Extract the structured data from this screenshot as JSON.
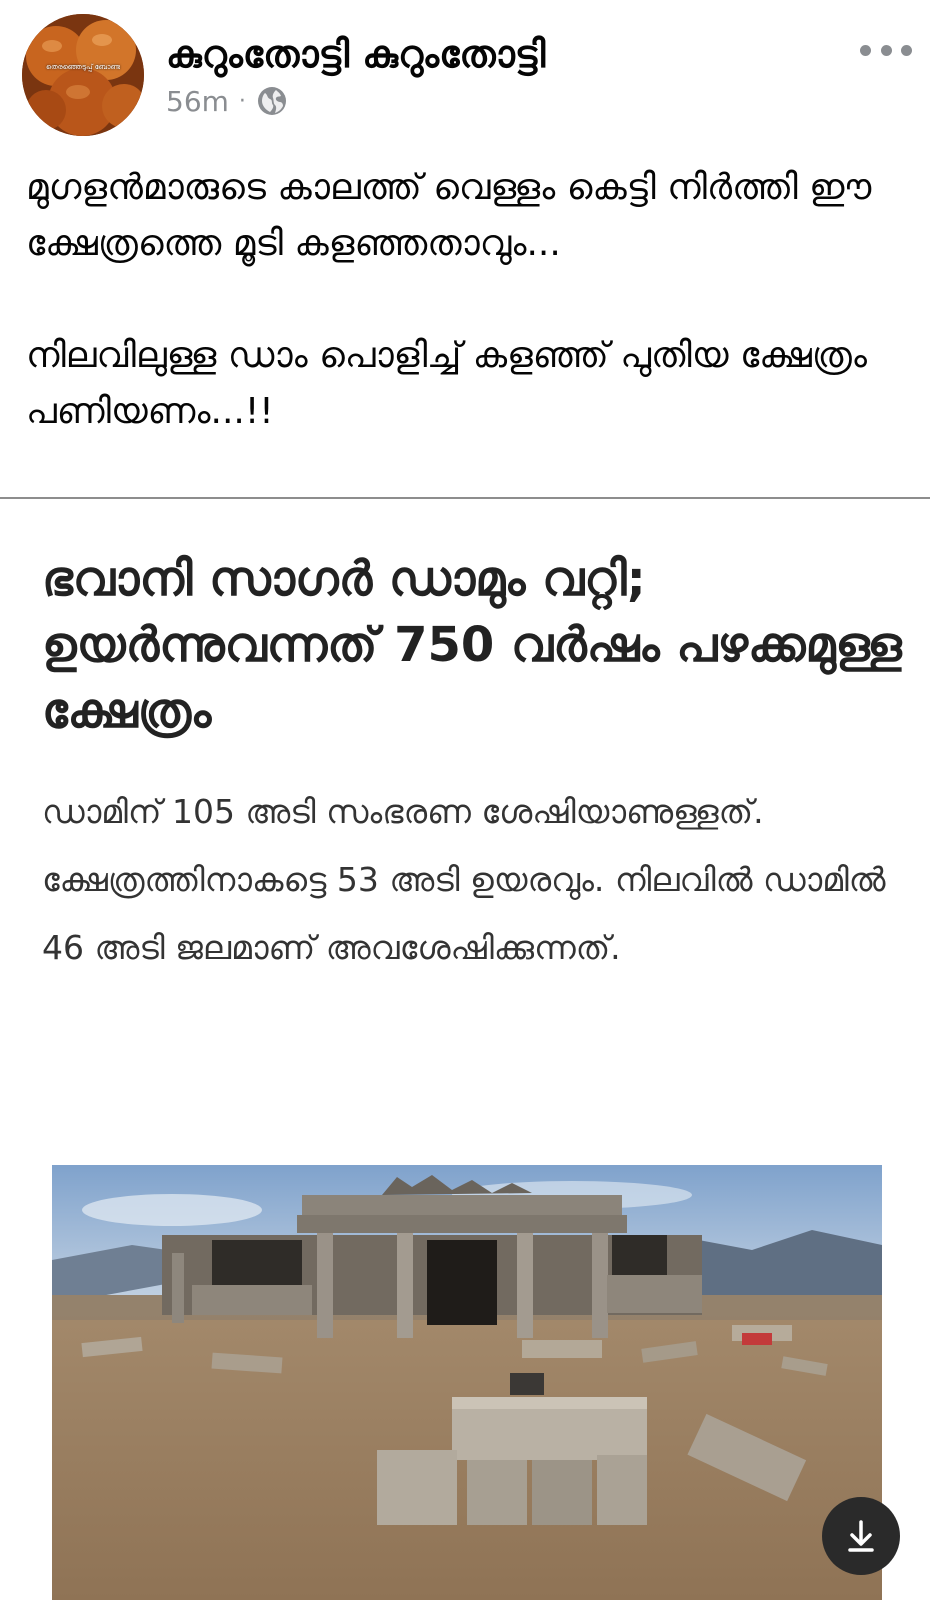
{
  "post": {
    "author_name": "കുറുംതോട്ടി കുറുംതോട്ടി",
    "timestamp": "56m",
    "meta_separator": "·",
    "privacy_icon": "globe-icon",
    "more_icon": "more-horizontal-icon",
    "avatar_caption": "തെരഞ്ഞെടുപ്പ് ബോണ്ട",
    "text_paragraphs": [
      "മുഗളൻമാരുടെ കാലത്ത് വെള്ളം കെട്ടി നിർത്തി ഈ ക്ഷേത്രത്തെ മൂടി കളഞ്ഞതാവും...",
      "നിലവിലുള്ള ഡാം പൊളിച്ച് കളഞ്ഞ് പുതിയ ക്ഷേത്രം പണിയണം...!!"
    ]
  },
  "article": {
    "headline": "ഭവാനി സാഗർ ഡാമും വറ്റി; ഉയർന്നുവന്നത് 750 വർഷം പഴക്കമുള്ള ക്ഷേത്രം",
    "summary": "ഡാമിന് 105 അടി സംഭരണ ശേഷിയാണുള്ളത്. ക്ഷേത്രത്തിനാകട്ടെ 53 അടി ഉയരവും. നിലവിൽ ഡാമിൽ 46 അടി ജലമാണ് അവശേഷിക്കുന്നത്.",
    "image_subject": "temple-ruins-in-dry-dam-bed",
    "download_icon": "download-arrow-icon"
  },
  "colors": {
    "name_text": "#050505",
    "meta_text": "#8a8d91",
    "headline_text": "#222222",
    "summary_text": "#333333",
    "divider": "#8d8d8d",
    "download_button_bg": "#2a2a2a"
  }
}
